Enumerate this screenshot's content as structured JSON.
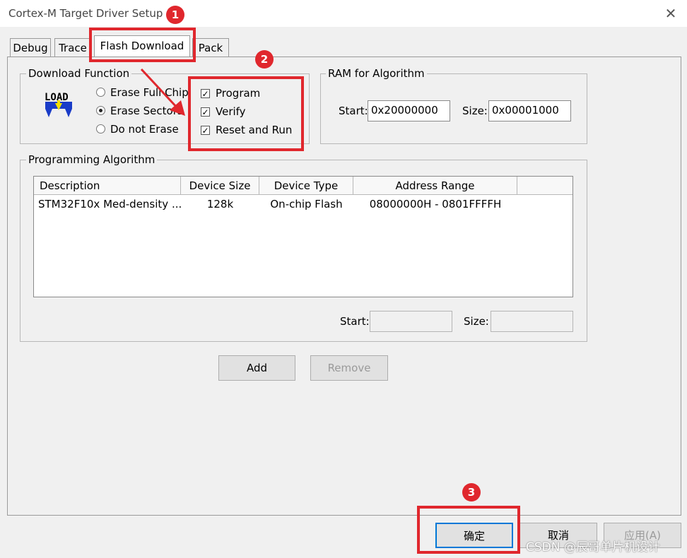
{
  "window": {
    "title": "Cortex-M Target Driver Setup",
    "close_glyph": "✕"
  },
  "tabs": [
    {
      "label": "Debug"
    },
    {
      "label": "Trace"
    },
    {
      "label": "Flash Download",
      "active": true
    },
    {
      "label": "Pack"
    }
  ],
  "download_function": {
    "legend": "Download Function",
    "icon_text": "LOAD",
    "erase_options": [
      {
        "label": "Erase Full Chip",
        "selected": false
      },
      {
        "label": "Erase Sectors",
        "selected": true
      },
      {
        "label": "Do not Erase",
        "selected": false
      }
    ],
    "checkboxes": [
      {
        "label": "Program",
        "checked": true
      },
      {
        "label": "Verify",
        "checked": true
      },
      {
        "label": "Reset and Run",
        "checked": true
      }
    ]
  },
  "ram_for_algorithm": {
    "legend": "RAM for Algorithm",
    "start_label": "Start:",
    "start_value": "0x20000000",
    "size_label": "Size:",
    "size_value": "0x00001000"
  },
  "programming_algorithm": {
    "legend": "Programming Algorithm",
    "columns": [
      "Description",
      "Device Size",
      "Device Type",
      "Address Range"
    ],
    "rows": [
      {
        "description": "STM32F10x Med-density ...",
        "device_size": "128k",
        "device_type": "On-chip Flash",
        "address_range": "08000000H - 0801FFFFH"
      }
    ],
    "start_label": "Start:",
    "start_value": "",
    "size_label": "Size:",
    "size_value": ""
  },
  "buttons": {
    "add": "Add",
    "remove": "Remove",
    "ok": "确定",
    "cancel": "取消",
    "apply": "应用(A)"
  },
  "annotations": {
    "badge_1": "1",
    "badge_2": "2",
    "badge_3": "3",
    "color": "#e0272d"
  },
  "watermark": "CSDN @辰哥单片机设计"
}
